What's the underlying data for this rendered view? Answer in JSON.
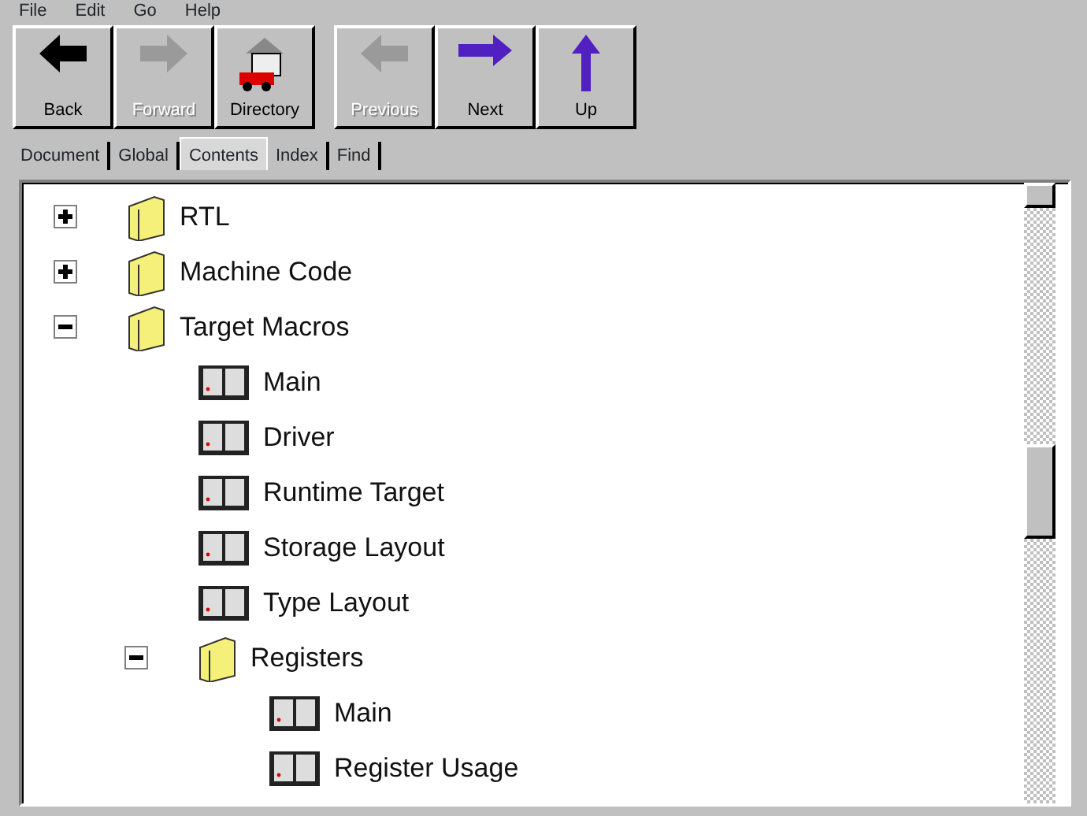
{
  "menu": [
    "File",
    "Edit",
    "Go",
    "Help"
  ],
  "toolbar": [
    {
      "label": "Back",
      "kind": "back",
      "disabled": false
    },
    {
      "label": "Forward",
      "kind": "forward",
      "disabled": true
    },
    {
      "label": "Directory",
      "kind": "directory",
      "disabled": false
    },
    {
      "label": "Previous",
      "kind": "back",
      "disabled": true
    },
    {
      "label": "Next",
      "kind": "next",
      "disabled": false
    },
    {
      "label": "Up",
      "kind": "up",
      "disabled": false
    }
  ],
  "tabs": [
    {
      "label": "Document",
      "selected": false
    },
    {
      "label": "Global",
      "selected": false
    },
    {
      "label": "Contents",
      "selected": true
    },
    {
      "label": "Index",
      "selected": false
    },
    {
      "label": "Find",
      "selected": false
    }
  ],
  "tree": [
    {
      "label": "RTL",
      "kind": "folder",
      "expanded": false
    },
    {
      "label": "Machine Code",
      "kind": "folder",
      "expanded": false
    },
    {
      "label": "Target Macros",
      "kind": "folder",
      "expanded": true,
      "children": [
        {
          "label": "Main",
          "kind": "page"
        },
        {
          "label": "Driver",
          "kind": "page"
        },
        {
          "label": "Runtime Target",
          "kind": "page"
        },
        {
          "label": "Storage Layout",
          "kind": "page"
        },
        {
          "label": "Type Layout",
          "kind": "page"
        },
        {
          "label": "Registers",
          "kind": "folder",
          "expanded": true,
          "children": [
            {
              "label": "Main",
              "kind": "page"
            },
            {
              "label": "Register Usage",
              "kind": "page"
            }
          ]
        }
      ]
    }
  ]
}
